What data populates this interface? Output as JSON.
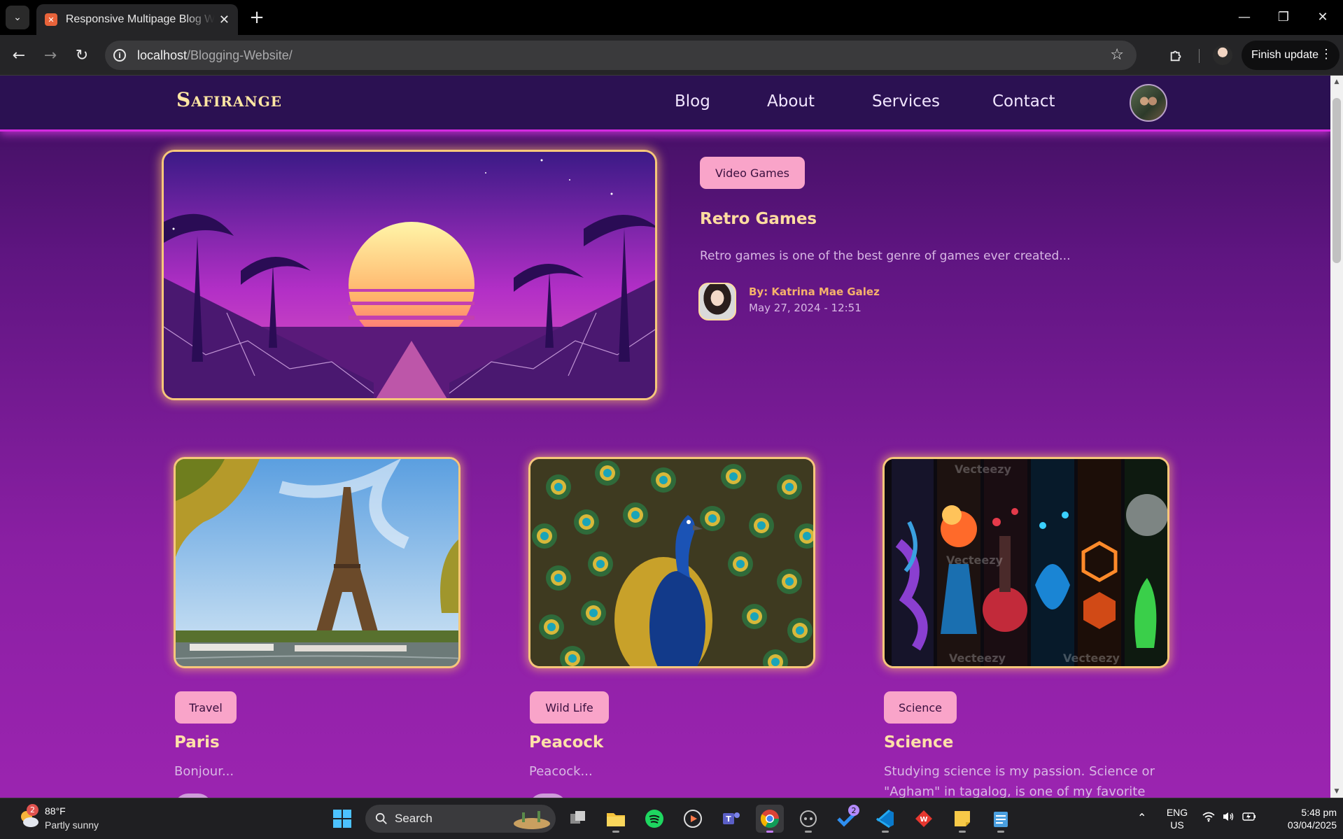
{
  "browser": {
    "tab_title": "Responsive Multipage Blog Website",
    "url_host": "localhost",
    "url_path": "/Blogging-Website/",
    "finish_update_label": "Finish update"
  },
  "site": {
    "logo": "Safirange",
    "nav": [
      "Blog",
      "About",
      "Services",
      "Contact"
    ]
  },
  "featured": {
    "category": "Video Games",
    "title": "Retro Games",
    "excerpt": "Retro games is one of the best genre of games ever created...",
    "author": "By: Katrina Mae Galez",
    "date": "May 27, 2024 - 12:51"
  },
  "posts": [
    {
      "category": "Travel",
      "title": "Paris",
      "excerpt": "Bonjour..."
    },
    {
      "category": "Wild Life",
      "title": "Peacock",
      "excerpt": "Peacock..."
    },
    {
      "category": "Science",
      "title": "Science",
      "excerpt_line1": "Studying science is my passion. Science or",
      "excerpt_line2": "\"Agham\" in tagalog, is one of my favorite"
    }
  ],
  "image_watermark": "Vecteezy",
  "taskbar": {
    "weather_temp": "88°F",
    "weather_cond": "Partly sunny",
    "weather_badge": "2",
    "search_label": "Search",
    "tasks_badge": "2",
    "lang": "ENG",
    "region": "US",
    "time": "5:48 pm",
    "date": "03/04/2025"
  },
  "colors": {
    "header_bg": "#2b1152",
    "accent_glow": "#d429e0",
    "badge_bg": "#f9a4c9",
    "title_gold": "#ffdca0"
  }
}
